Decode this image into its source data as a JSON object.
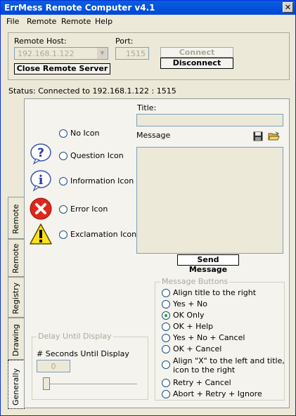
{
  "window": {
    "title": "ErrMess Remote Computer v4.1",
    "close": "✕"
  },
  "menu": [
    "File",
    "Remote",
    "Remote",
    "Help"
  ],
  "remote": {
    "host_label": "Remote Host:",
    "host_value": "192.168.1.122",
    "port_label": "Port:",
    "port_value": "1515",
    "connect": "Connect",
    "disconnect": "Disconnect",
    "close_server": "Close Remote Server"
  },
  "status": "Status: Connected to 192.168.1.122 : 1515",
  "tabs": [
    "Remote",
    "Remote",
    "Registry",
    "Drawing",
    "Generally"
  ],
  "icons": [
    {
      "label": "No Icon",
      "icon": "none"
    },
    {
      "label": "Question Icon",
      "icon": "question-icon"
    },
    {
      "label": "Information Icon",
      "icon": "information-icon"
    },
    {
      "label": "Error Icon",
      "icon": "error-icon"
    },
    {
      "label": "Exclamation Icon",
      "icon": "exclamation-icon"
    }
  ],
  "title_label": "Title:",
  "message_label": "Message",
  "send_message": "Send Message",
  "message_buttons": {
    "legend": "Message Buttons",
    "options": [
      {
        "label": "Align title to the right",
        "checked": false
      },
      {
        "label": "Yes + No",
        "checked": false
      },
      {
        "label": "OK Only",
        "checked": true
      },
      {
        "label": "OK + Help",
        "checked": false
      },
      {
        "label": "Yes + No + Cancel",
        "checked": false
      },
      {
        "label": "OK + Cancel",
        "checked": false
      },
      {
        "label": "Align \"X\" to the left and title,",
        "label2": "icon to the right",
        "checked": false
      },
      {
        "label": "Retry + Cancel",
        "checked": false
      },
      {
        "label": "Abort + Retry + Ignore",
        "checked": false
      }
    ]
  },
  "delay": {
    "legend": "Delay Until Display",
    "seconds_label": "# Seconds Until Display",
    "value": "0"
  }
}
